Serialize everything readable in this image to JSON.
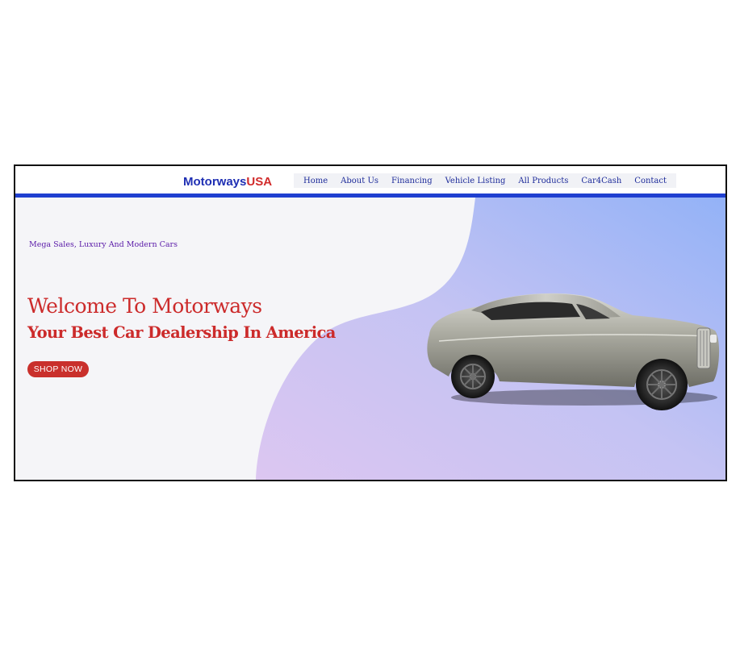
{
  "brand": {
    "name_part1": "Motorways",
    "name_part2": "USA"
  },
  "nav": {
    "items": [
      {
        "label": "Home"
      },
      {
        "label": "About Us"
      },
      {
        "label": "Financing"
      },
      {
        "label": "Vehicle Listing"
      },
      {
        "label": "All Products"
      },
      {
        "label": "Car4Cash"
      },
      {
        "label": "Contact"
      }
    ]
  },
  "hero": {
    "tagline": "Mega Sales, Luxury And Modern Cars",
    "headline": "Welcome To Motorways",
    "subheadline": "Your Best Car Dealership In America",
    "cta_label": "SHOP NOW"
  },
  "colors": {
    "accent_bar": "#1f3fd0",
    "headline": "#cc2b2b",
    "cta": "#c9302c",
    "nav_link": "#1d2b9a",
    "tagline": "#5a1aa8"
  },
  "icons": {
    "hero_image": "silver-luxury-car"
  }
}
